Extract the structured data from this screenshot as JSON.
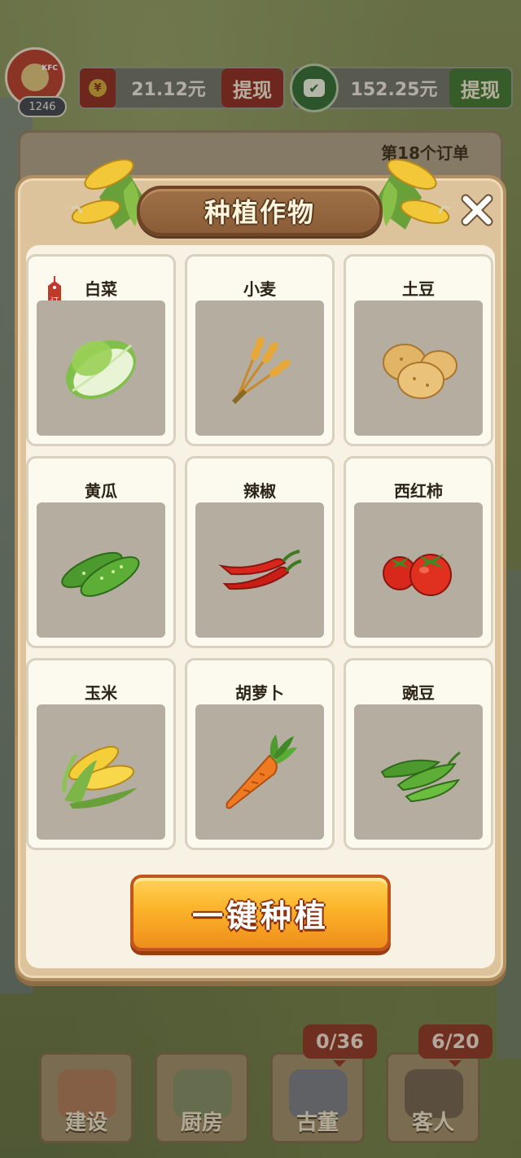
{
  "header": {
    "level": "1246",
    "wallet_red": {
      "amount": "21.12元",
      "withdraw_label": "提现",
      "icon": "red-coin-icon",
      "icon_glyph": "¥"
    },
    "wallet_green": {
      "amount": "152.25元",
      "withdraw_label": "提现",
      "icon": "wechat-icon",
      "icon_glyph": "✔"
    },
    "avatar_text": "KFC"
  },
  "order_panel": {
    "text": "第18个订单"
  },
  "modal": {
    "title": "种植作物",
    "close_glyph": "✖",
    "order_tag": "订单",
    "crops": [
      {
        "name": "白菜",
        "icon": "napa-cabbage-icon",
        "tagged": true
      },
      {
        "name": "小麦",
        "icon": "wheat-icon",
        "tagged": false
      },
      {
        "name": "土豆",
        "icon": "potato-icon",
        "tagged": false
      },
      {
        "name": "黄瓜",
        "icon": "cucumber-icon",
        "tagged": false
      },
      {
        "name": "辣椒",
        "icon": "chili-pepper-icon",
        "tagged": false
      },
      {
        "name": "西红柿",
        "icon": "tomato-icon",
        "tagged": false
      },
      {
        "name": "玉米",
        "icon": "corn-icon",
        "tagged": false
      },
      {
        "name": "胡萝卜",
        "icon": "carrot-icon",
        "tagged": false
      },
      {
        "name": "豌豆",
        "icon": "pea-pod-icon",
        "tagged": false
      }
    ],
    "plant_all_label": "一键种植"
  },
  "bottom_nav": [
    {
      "label": "建设",
      "badge": null
    },
    {
      "label": "厨房",
      "badge": null
    },
    {
      "label": "古董",
      "badge": "0/36"
    },
    {
      "label": "客人",
      "badge": "6/20"
    }
  ],
  "colors": {
    "accent_orange": "#fbb329",
    "wood": "#8a5d38",
    "card_art_bg": "#b5ada0"
  }
}
